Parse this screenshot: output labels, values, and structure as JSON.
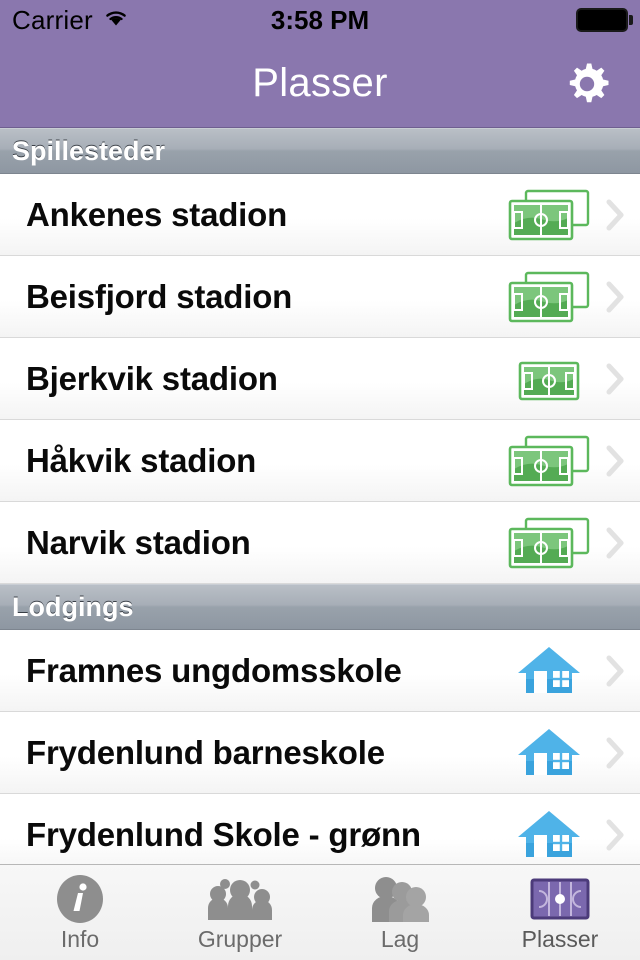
{
  "status_bar": {
    "carrier": "Carrier",
    "wifi_icon": "wifi-icon",
    "time": "3:58 PM",
    "battery_icon": "battery-full-icon"
  },
  "nav_bar": {
    "title": "Plasser",
    "settings_icon": "gear-icon"
  },
  "colors": {
    "nav_purple": "#8a77ae",
    "field_green": "#5cb85c",
    "house_blue": "#4fb3e8",
    "tab_gray": "#8e8e8e",
    "active_purple": "#7b68ae"
  },
  "sections": [
    {
      "header": "Spillesteder",
      "rows": [
        {
          "title": "Ankenes stadion",
          "icon": "soccer-field-stack-icon",
          "icon_kind": "field-stack",
          "chevron": "chevron-right-icon"
        },
        {
          "title": "Beisfjord stadion",
          "icon": "soccer-field-stack-icon",
          "icon_kind": "field-stack",
          "chevron": "chevron-right-icon"
        },
        {
          "title": "Bjerkvik stadion",
          "icon": "soccer-field-icon",
          "icon_kind": "field-single",
          "chevron": "chevron-right-icon"
        },
        {
          "title": "Håkvik stadion",
          "icon": "soccer-field-stack-icon",
          "icon_kind": "field-stack",
          "chevron": "chevron-right-icon"
        },
        {
          "title": "Narvik stadion",
          "icon": "soccer-field-stack-icon",
          "icon_kind": "field-stack",
          "chevron": "chevron-right-icon"
        }
      ]
    },
    {
      "header": "Lodgings",
      "rows": [
        {
          "title": "Framnes ungdomsskole",
          "icon": "house-icon",
          "icon_kind": "house",
          "chevron": "chevron-right-icon"
        },
        {
          "title": "Frydenlund barneskole",
          "icon": "house-icon",
          "icon_kind": "house",
          "chevron": "chevron-right-icon"
        },
        {
          "title": "Frydenlund Skole - grønn",
          "icon": "house-icon",
          "icon_kind": "house",
          "chevron": "chevron-right-icon"
        }
      ]
    }
  ],
  "tab_bar": {
    "active_index": 3,
    "tabs": [
      {
        "label": "Info",
        "icon": "info-circle-icon"
      },
      {
        "label": "Grupper",
        "icon": "group-people-icon"
      },
      {
        "label": "Lag",
        "icon": "team-people-icon"
      },
      {
        "label": "Plasser",
        "icon": "field-purple-icon"
      }
    ]
  }
}
